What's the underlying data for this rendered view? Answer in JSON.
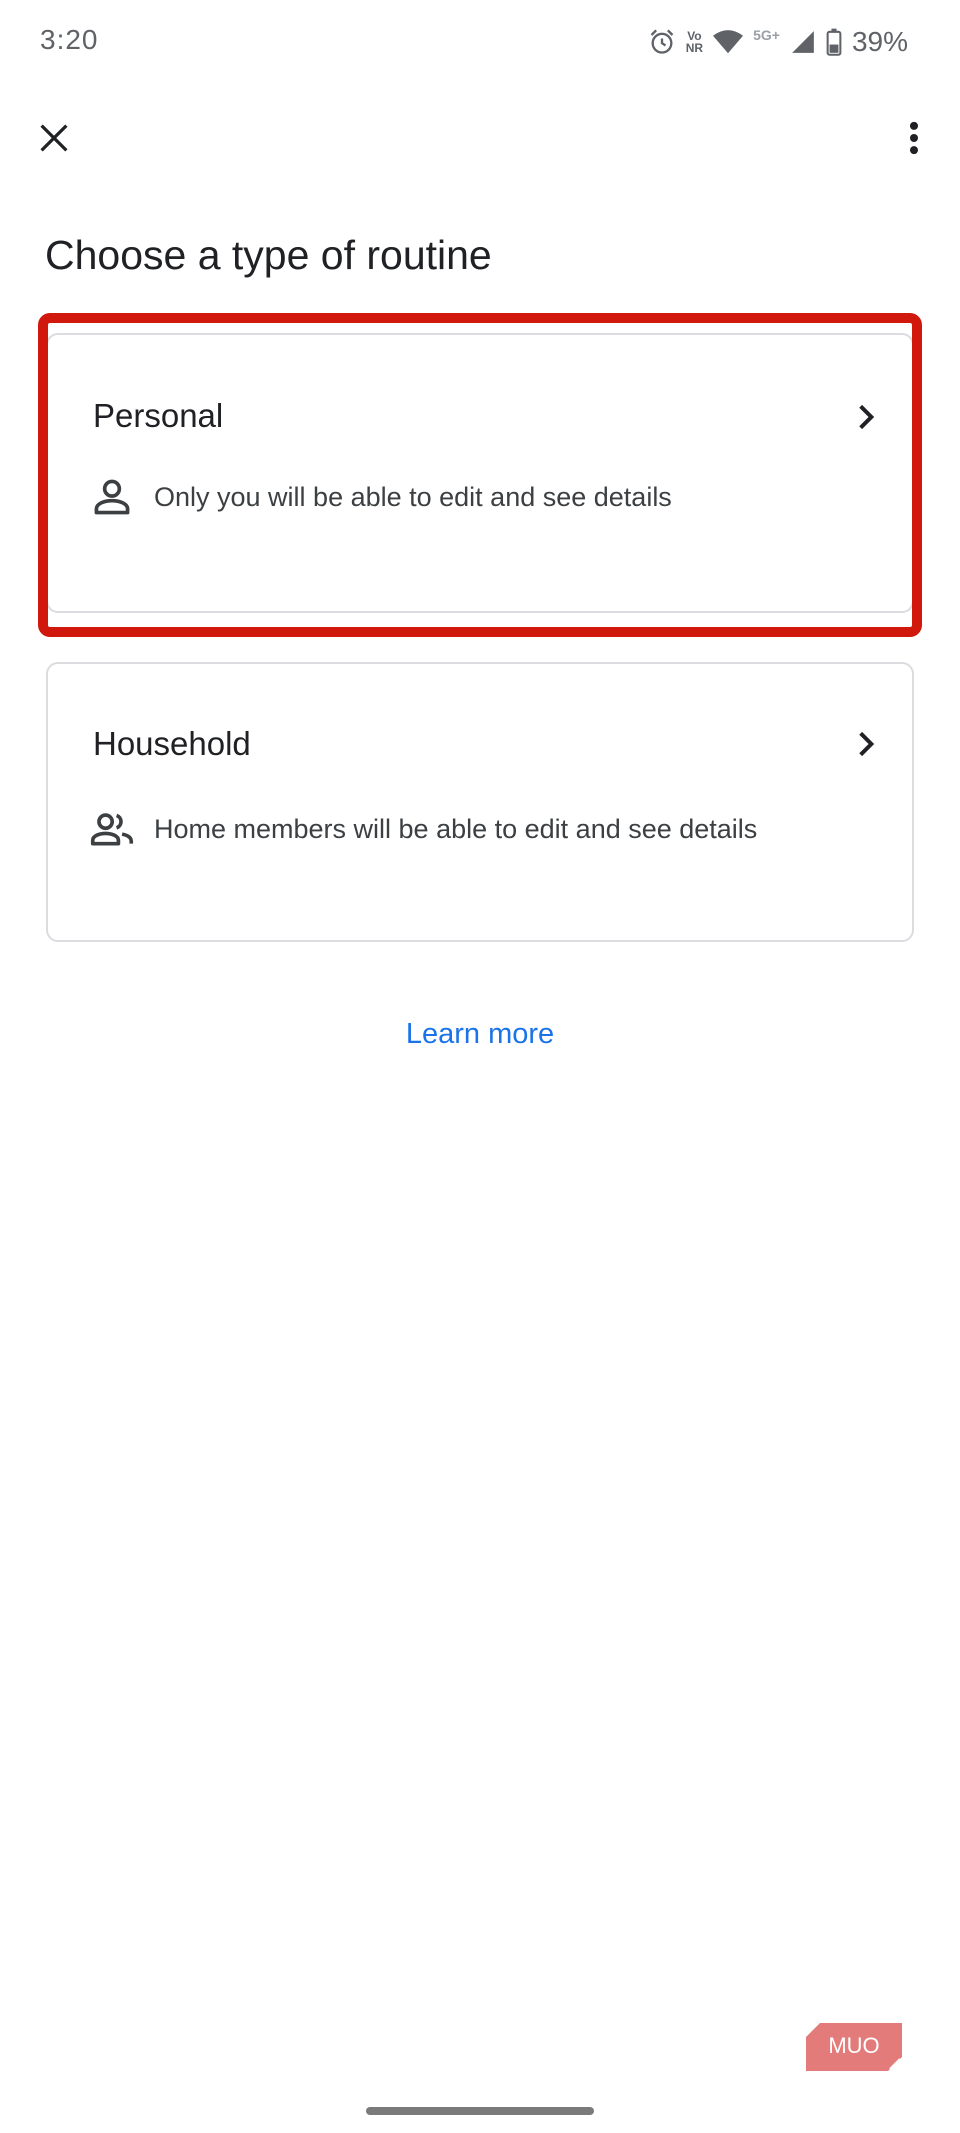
{
  "status_bar": {
    "time": "3:20",
    "network_label": "Vo NR",
    "network_label_top": "Vo",
    "network_label_bottom": "NR",
    "cellular_label": "5G+",
    "battery_percent": "39%",
    "icons": [
      "alarm-icon",
      "wifi-icon",
      "signal-icon",
      "battery-icon"
    ]
  },
  "app_bar": {
    "close_icon": "close-icon",
    "menu_icon": "more-vert-icon"
  },
  "page": {
    "title": "Choose a type of routine"
  },
  "options": [
    {
      "title": "Personal",
      "description": "Only you will be able to edit and see details",
      "icon": "person-icon",
      "highlighted": true
    },
    {
      "title": "Household",
      "description": "Home members will be able to edit and see details",
      "icon": "group-icon",
      "highlighted": false
    }
  ],
  "learn_more": "Learn more",
  "watermark": "MUO",
  "colors": {
    "link": "#1a73e8",
    "highlight": "#d0180c",
    "card_border": "#dadce0",
    "text_primary": "#202124",
    "watermark": "#e47b7b"
  }
}
